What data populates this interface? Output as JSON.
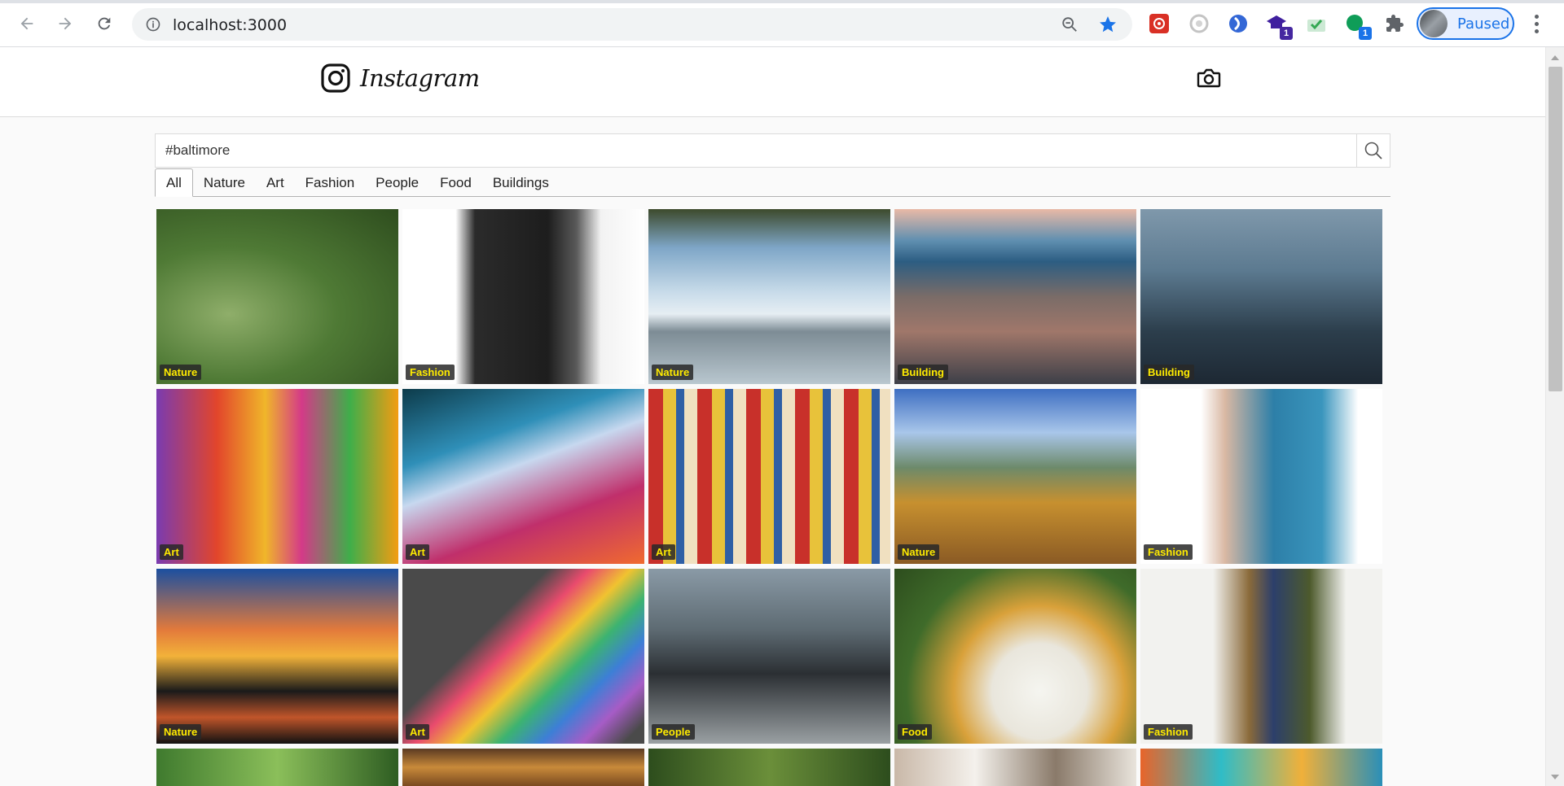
{
  "browser": {
    "url": "localhost:3000",
    "profile_status": "Paused",
    "ext_badges": [
      "1",
      "1"
    ]
  },
  "header": {
    "brand": "Instagram"
  },
  "search": {
    "value": "#baltimore"
  },
  "tabs": [
    "All",
    "Nature",
    "Art",
    "Fashion",
    "People",
    "Food",
    "Buildings"
  ],
  "active_tab": "All",
  "tiles": [
    {
      "label": "Nature"
    },
    {
      "label": "Fashion"
    },
    {
      "label": "Nature"
    },
    {
      "label": "Building"
    },
    {
      "label": "Building"
    },
    {
      "label": "Art"
    },
    {
      "label": "Art"
    },
    {
      "label": "Art"
    },
    {
      "label": "Nature"
    },
    {
      "label": "Fashion"
    },
    {
      "label": "Nature"
    },
    {
      "label": "Art"
    },
    {
      "label": "People"
    },
    {
      "label": "Food"
    },
    {
      "label": "Fashion"
    },
    {
      "label": ""
    },
    {
      "label": ""
    },
    {
      "label": ""
    },
    {
      "label": ""
    },
    {
      "label": ""
    }
  ],
  "colors": {
    "label_text": "#ffeb00",
    "accent": "#1a73e8"
  }
}
